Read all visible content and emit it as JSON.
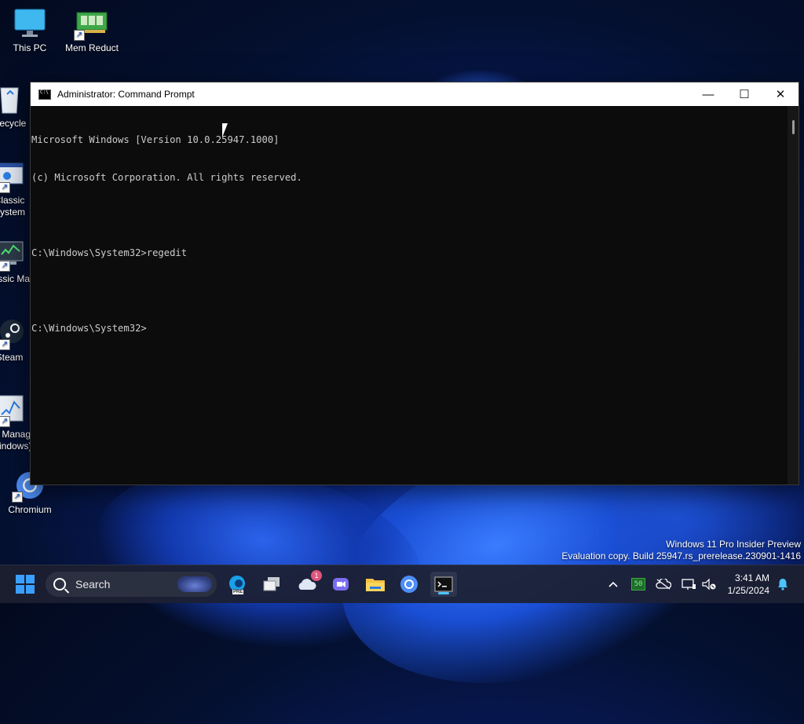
{
  "desktop": {
    "icons": [
      {
        "label": "This PC"
      },
      {
        "label": "Mem Reduct"
      },
      {
        "label": "Recycle"
      },
      {
        "label": "Classic System"
      },
      {
        "label": "Classic Man"
      },
      {
        "label": "Steam"
      },
      {
        "label": "Task Manager (Windows)"
      },
      {
        "label": "Chromium"
      }
    ]
  },
  "window": {
    "title": "Administrator: Command Prompt",
    "controls": {
      "minimize": "—",
      "maximize": "☐",
      "close": "✕"
    },
    "lines": [
      "Microsoft Windows [Version 10.0.25947.1000]",
      "(c) Microsoft Corporation. All rights reserved.",
      "",
      "C:\\Windows\\System32>regedit",
      "",
      "C:\\Windows\\System32>"
    ]
  },
  "watermark": {
    "line1": "Windows 11 Pro Insider Preview",
    "line2": "Evaluation copy. Build 25947.rs_prerelease.230901-1416"
  },
  "taskbar": {
    "search_placeholder": "Search",
    "apps": [
      "edge-pre-icon",
      "task-view-icon",
      "onedrive-icon",
      "meet-icon",
      "file-explorer-icon",
      "chromium-icon",
      "terminal-icon"
    ],
    "onedrive_badge": "1",
    "edge_label": "PRE",
    "tray": {
      "battery_text": "50",
      "time": "3:41 AM",
      "date": "1/25/2024"
    }
  },
  "colors": {
    "accent": "#4cc2ff",
    "console_bg": "#0c0c0c",
    "console_fg": "#cccccc"
  }
}
